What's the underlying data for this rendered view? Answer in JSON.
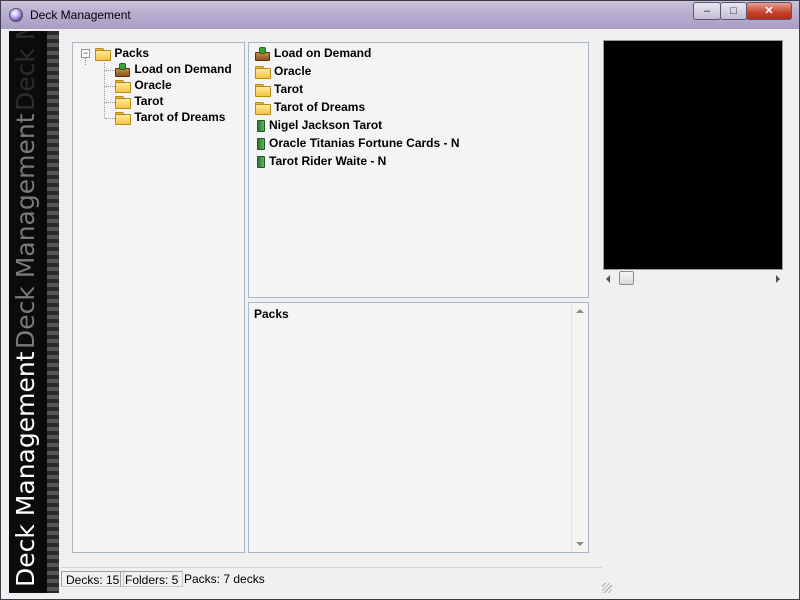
{
  "window": {
    "title": "Deck Management",
    "minimize_glyph": "–",
    "maximize_glyph": "□",
    "close_glyph": "✕"
  },
  "sidebar": {
    "brand_text": "Deck Management"
  },
  "tree": {
    "root": {
      "label": "Packs",
      "expanded": true,
      "expander_glyph": "−",
      "icon": "folder-open-icon"
    },
    "children": [
      {
        "label": "Load on Demand",
        "icon": "load-on-demand-icon"
      },
      {
        "label": "Oracle",
        "icon": "folder-icon"
      },
      {
        "label": "Tarot",
        "icon": "folder-icon"
      },
      {
        "label": "Tarot of Dreams",
        "icon": "folder-icon"
      }
    ]
  },
  "list": {
    "items": [
      {
        "label": "Load on Demand",
        "icon": "load-on-demand-icon"
      },
      {
        "label": "Oracle",
        "icon": "folder-icon"
      },
      {
        "label": "Tarot",
        "icon": "folder-icon"
      },
      {
        "label": "Tarot of Dreams",
        "icon": "folder-icon"
      },
      {
        "label": "Nigel Jackson Tarot",
        "icon": "deck-icon"
      },
      {
        "label": "Oracle Titanias Fortune Cards - N",
        "icon": "deck-icon"
      },
      {
        "label": "Tarot Rider Waite - N",
        "icon": "deck-icon"
      }
    ]
  },
  "info": {
    "heading": "Packs"
  },
  "status": {
    "decks": "Decks: 15",
    "folders": "Folders: 5",
    "packs": "Packs: 7 decks"
  },
  "colors": {
    "accent_folder": "#f4c443",
    "deck_green": "#3a8f3a",
    "preview_bg": "#000000",
    "close_red": "#c7402a"
  }
}
